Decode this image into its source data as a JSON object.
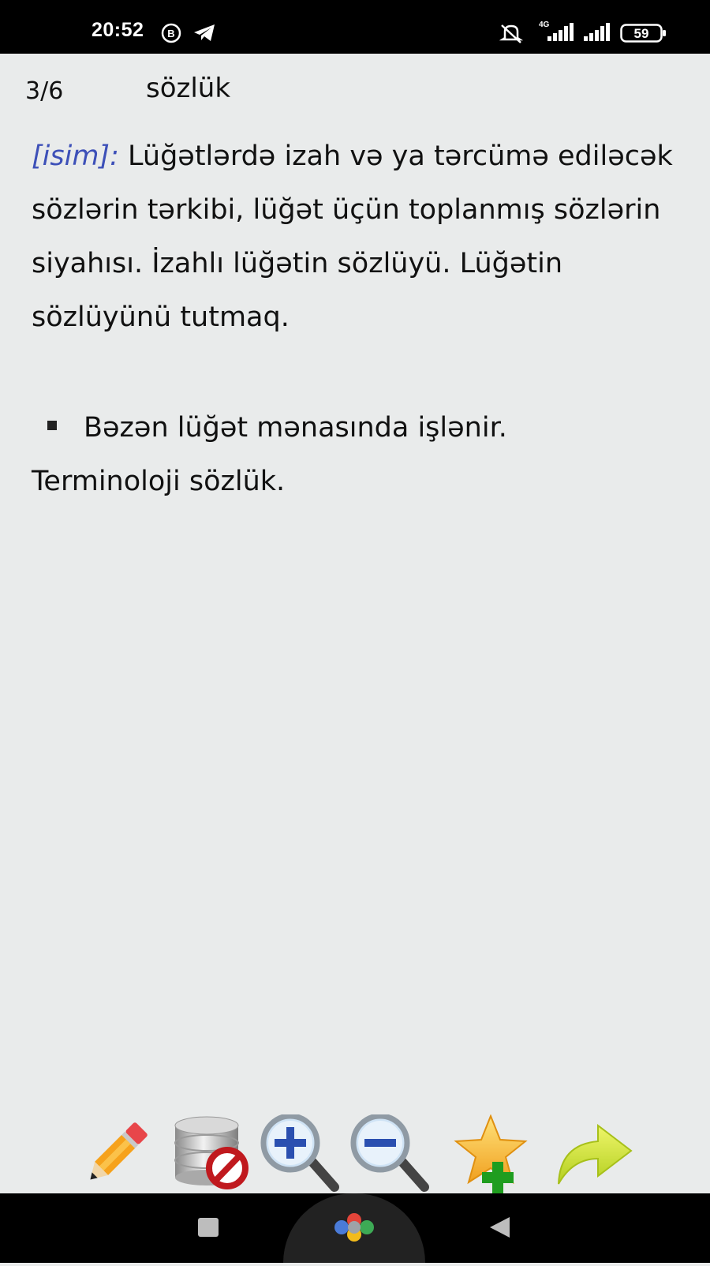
{
  "status_bar": {
    "time": "20:52",
    "icons": [
      "b-circle-icon",
      "telegram-icon",
      "mute-icon",
      "signal-4g-icon",
      "signal-icon",
      "battery-icon"
    ],
    "network": "4G",
    "battery": "59"
  },
  "header": {
    "counter": "3/6",
    "word": "sözlük"
  },
  "definition": {
    "pos": "[isim]:",
    "text": " Lüğətlərdə izah və ya tərcümə ediləcək sözlərin tərkibi, lüğət üçün toplanmış sözlərin siyahısı. İzahlı lüğətin sözlüyü. Lüğətin sözlüyünü tutmaq.",
    "example_line1": "Bəzən lüğət mənasında işlənir.",
    "example_line2": "Terminoloji sözlük."
  },
  "toolbar": {
    "items": [
      "edit-pencil-icon",
      "database-delete-icon",
      "zoom-in-icon",
      "zoom-out-icon",
      "add-favorite-icon",
      "share-forward-icon"
    ]
  },
  "colors": {
    "background": "#e9ebeb",
    "pos_label": "#3d50b8",
    "bars": "#000000"
  }
}
